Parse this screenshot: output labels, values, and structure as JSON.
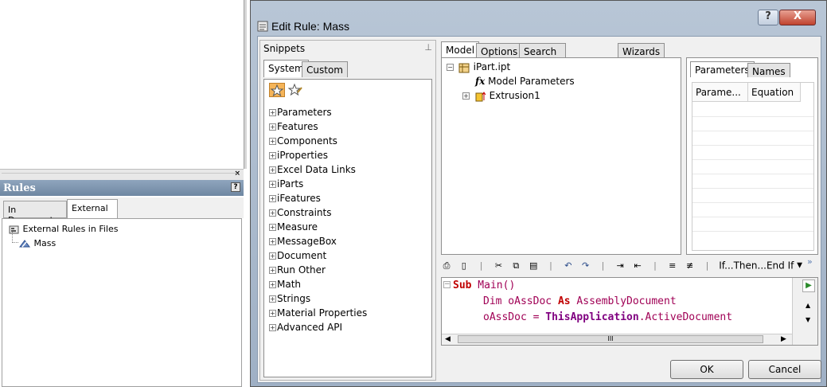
{
  "left_panel": {
    "title": "Rules",
    "help_icon": "?",
    "tabs": [
      "In Document",
      "External"
    ],
    "tree": [
      {
        "label": "External Rules in Files",
        "icon": "rules-folder-icon"
      },
      {
        "label": "Mass",
        "icon": "rule-icon"
      }
    ]
  },
  "dialog": {
    "title": "Edit Rule: Mass",
    "help_label": "?",
    "close_label": "X",
    "snippets": {
      "title": "Snippets",
      "tabs": [
        "System",
        "Custom"
      ],
      "items": [
        "Parameters",
        "Features",
        "Components",
        "iProperties",
        "Excel Data Links",
        "iParts",
        "iFeatures",
        "Constraints",
        "Measure",
        "MessageBox",
        "Document",
        "Run Other",
        "Math",
        "Strings",
        "Material Properties",
        "Advanced API"
      ]
    },
    "model_tabs": [
      "Model",
      "Options",
      "Search and Replace",
      "Wizards"
    ],
    "model_tree": {
      "root": "iPart.ipt",
      "children": [
        "Model Parameters",
        "Extrusion1"
      ]
    },
    "params_tabs": [
      "Parameters",
      "Names"
    ],
    "params_columns": [
      "Parame...",
      "Equation"
    ],
    "toolbar": {
      "if_then_label": "If...Then...End If",
      "dropdown_icon": "▼"
    },
    "code": {
      "line1_kw": "Sub",
      "line1_rest": " Main()",
      "line2_kw": "Dim",
      "line2_var": " oAssDoc ",
      "line2_as": "As",
      "line2_type": " AssemblyDocument",
      "line3_var": "oAssDoc = ",
      "line3_obj": "ThisApplication",
      "line3_rest": ".ActiveDocument"
    },
    "scroll_thumb_label": "III",
    "buttons": {
      "ok": "OK",
      "cancel": "Cancel"
    }
  }
}
